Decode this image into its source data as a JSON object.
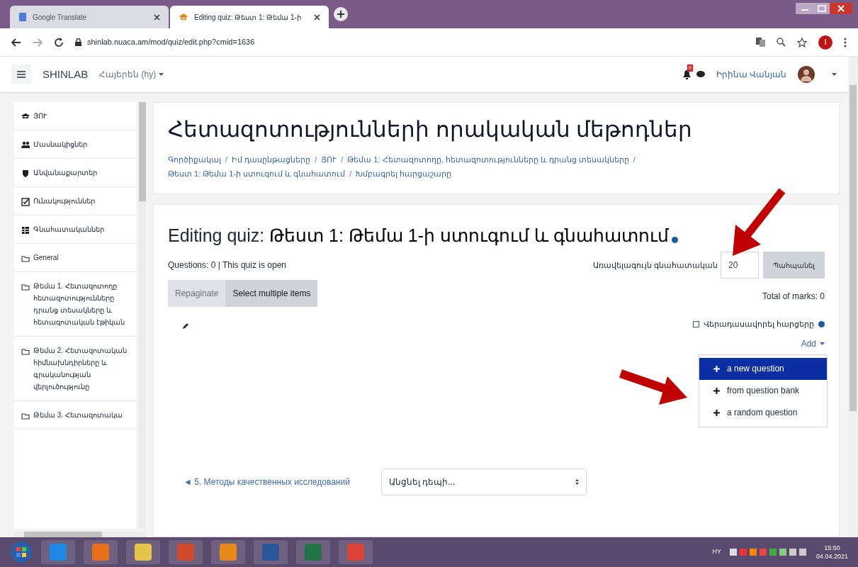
{
  "browser": {
    "tabs": [
      {
        "title": "Google Translate",
        "selected": false
      },
      {
        "title": "Editing quiz: Թեստ 1: Թեմա 1-ի",
        "selected": true
      }
    ],
    "url": "shinlab.nuaca.am/mod/quiz/edit.php?cmid=1636",
    "profile_initial": "I"
  },
  "navbar": {
    "site": "SHINLAB",
    "language": "Հայերեն (hy)",
    "notification_count": "6",
    "user": "Իրինա Վանյան"
  },
  "sidebar": {
    "items": [
      {
        "kind": "course",
        "label": "ՅՈՒ"
      },
      {
        "kind": "participants",
        "label": "Մասնակիցներ"
      },
      {
        "kind": "badges",
        "label": "Անվանաքարտեր"
      },
      {
        "kind": "competencies",
        "label": "Ունակություններ"
      },
      {
        "kind": "grades",
        "label": "Գնահատականներ"
      },
      {
        "kind": "section",
        "label": "General"
      },
      {
        "kind": "section",
        "label": "Թեմա 1. Հետազոտողը հետազոտությունները դրանց տեսակները և հետազոտական էթիկան"
      },
      {
        "kind": "section",
        "label": "Թեմա 2. Հետազոտական հիմնախնդիրները և գրականության վերլուծությունը"
      },
      {
        "kind": "section",
        "label": "Թեմա 3. Հետազոտակա"
      }
    ]
  },
  "header": {
    "course_title": "Հետազոտությունների որակական մեթոդներ",
    "breadcrumb_separator": "/",
    "breadcrumb": [
      "Գործիքակալ",
      "Իմ դասընթացները",
      "ՅՈՒ",
      "Թեմա 1: Հետազոտողը, հետազոտությունները և դրանց տեսակները",
      "Թեստ 1: Թեմա 1-ի ստուգում և գնահատում",
      "Խմբագրել հարցաշարը"
    ]
  },
  "quiz": {
    "heading_prefix": "Editing quiz:",
    "heading_name": "Թեստ 1: Թեմա 1-ի ստուգում և գնահատում",
    "status": "Questions: 0 | This quiz is open",
    "max_grade_label": "Առավելագույն գնահատական",
    "max_grade": "20",
    "save_button": "Պահպանել",
    "buttons": [
      {
        "label": "Repaginate",
        "disabled": true
      },
      {
        "label": "Select multiple items",
        "disabled": false
      }
    ],
    "total_marks": "Total of marks: 0",
    "shuffle": {
      "label": "Վերադասավորել հարցերը",
      "checked": false
    },
    "add_menu": {
      "label": "Add",
      "items": [
        {
          "label": "a new question",
          "selected": true
        },
        {
          "label": "from question bank",
          "selected": false
        },
        {
          "label": "a random question",
          "selected": false
        }
      ]
    }
  },
  "footer": {
    "prev_link": "◄ 5. Методы качественных исследований",
    "jump_placeholder": "Անցնել դեպի..."
  },
  "taskbar": {
    "language": "HY",
    "time": "15:50",
    "date": "04.04.2021"
  }
}
